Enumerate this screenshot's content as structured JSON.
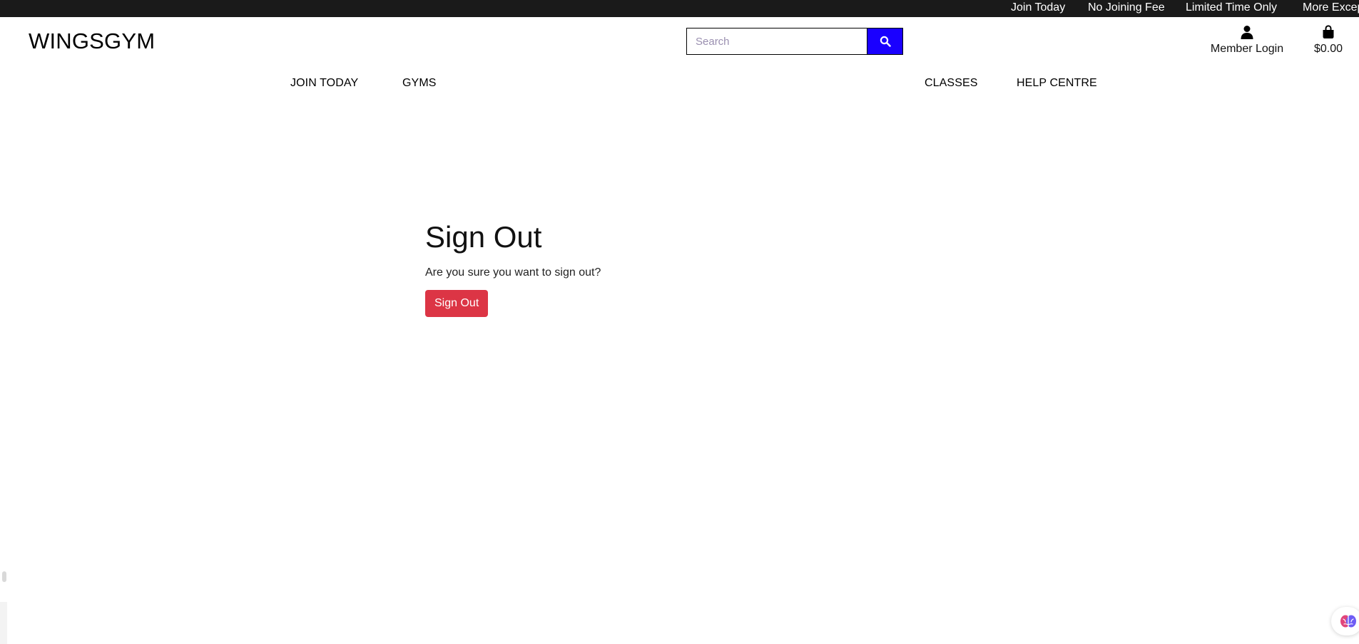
{
  "ticker": {
    "items": [
      "Join Today",
      "No Joining Fee",
      "Limited Time Only",
      "More Excep"
    ]
  },
  "header": {
    "brand": "WINGSGYM",
    "search": {
      "placeholder": "Search"
    },
    "account": {
      "label": "Member Login",
      "icon": "user-icon"
    },
    "bag": {
      "total": "$0.00",
      "icon": "shopping-bag-icon"
    }
  },
  "nav": {
    "join": "JOIN TODAY",
    "gyms": "GYMS",
    "classes": "CLASSES",
    "help": "HELP CENTRE"
  },
  "main": {
    "title": "Sign Out",
    "prompt": "Are you sure you want to sign out?",
    "button": "Sign Out"
  },
  "colors": {
    "ticker_bg": "#1a1a1a",
    "search_button": "#1a00ff",
    "danger_button": "#dc3545"
  }
}
